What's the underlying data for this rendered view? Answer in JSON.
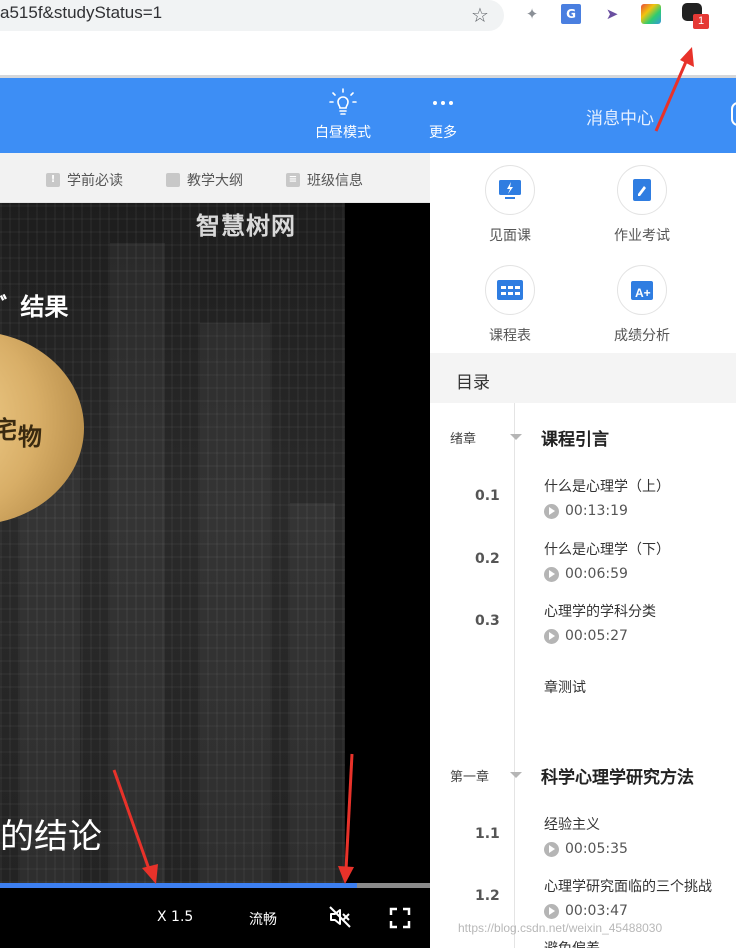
{
  "browser": {
    "url_fragment": "a515f&studyStatus=1",
    "ext_badge": "1",
    "ext_translate_label": "G"
  },
  "nav": {
    "daylight_label": "白昼模式",
    "more_label": "更多",
    "messages_label": "消息中心"
  },
  "subbar": {
    "items": [
      "学前必读",
      "教学大纲",
      "班级信息"
    ]
  },
  "video": {
    "logo": "智慧树网",
    "result_text": "结果",
    "circle_text": "物",
    "circle_partial": "宅",
    "conclusion": "的结论",
    "progress_percent": 83,
    "speed": "X 1.5",
    "quality": "流畅"
  },
  "tools": [
    {
      "label": "见面课",
      "icon": "meeting-icon"
    },
    {
      "label": "作业考试",
      "icon": "homework-icon"
    },
    {
      "label": "课程表",
      "icon": "schedule-icon"
    },
    {
      "label": "成绩分析",
      "icon": "grade-analysis-icon"
    }
  ],
  "catalog": {
    "title": "目录",
    "chapters": [
      {
        "tag": "绪章",
        "title": "课程引言",
        "lessons": [
          {
            "num": "0.1",
            "title": "什么是心理学（上）",
            "duration": "00:13:19"
          },
          {
            "num": "0.2",
            "title": "什么是心理学（下）",
            "duration": "00:06:59"
          },
          {
            "num": "0.3",
            "title": "心理学的学科分类",
            "duration": "00:05:27"
          },
          {
            "num": "",
            "title": "章测试",
            "duration": ""
          }
        ]
      },
      {
        "tag": "第一章",
        "title": "科学心理学研究方法",
        "lessons": [
          {
            "num": "1.1",
            "title": "经验主义",
            "duration": "00:05:35"
          },
          {
            "num": "1.2",
            "title": "心理学研究面临的三个挑战",
            "duration": "00:03:47"
          },
          {
            "num": "",
            "title": "避免偏差",
            "duration": ""
          }
        ]
      }
    ]
  },
  "watermark": "https://blog.csdn.net/weixin_45488030",
  "colors": {
    "nav_blue": "#3d8ef5",
    "progress_blue": "#3d7ff0",
    "arrow_red": "#e8322a"
  }
}
